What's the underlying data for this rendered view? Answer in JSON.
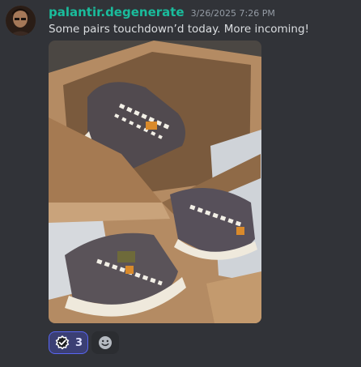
{
  "message": {
    "username": "palantir.degenerate",
    "timestamp": "3/26/2025 7:26 PM",
    "content": "Some pairs touchdown’d today. More incoming!"
  },
  "reactions": [
    {
      "emoji": "verified-check-icon",
      "count": "3",
      "selected": true
    }
  ],
  "add_reaction": {
    "icon": "smiley-face-icon"
  },
  "colors": {
    "background": "#313338",
    "username": "#1abc9c",
    "text": "#dbdee1",
    "timestamp": "#949ba4",
    "reaction_active_bg": "#3b3f74",
    "reaction_active_border": "#5865f2"
  }
}
